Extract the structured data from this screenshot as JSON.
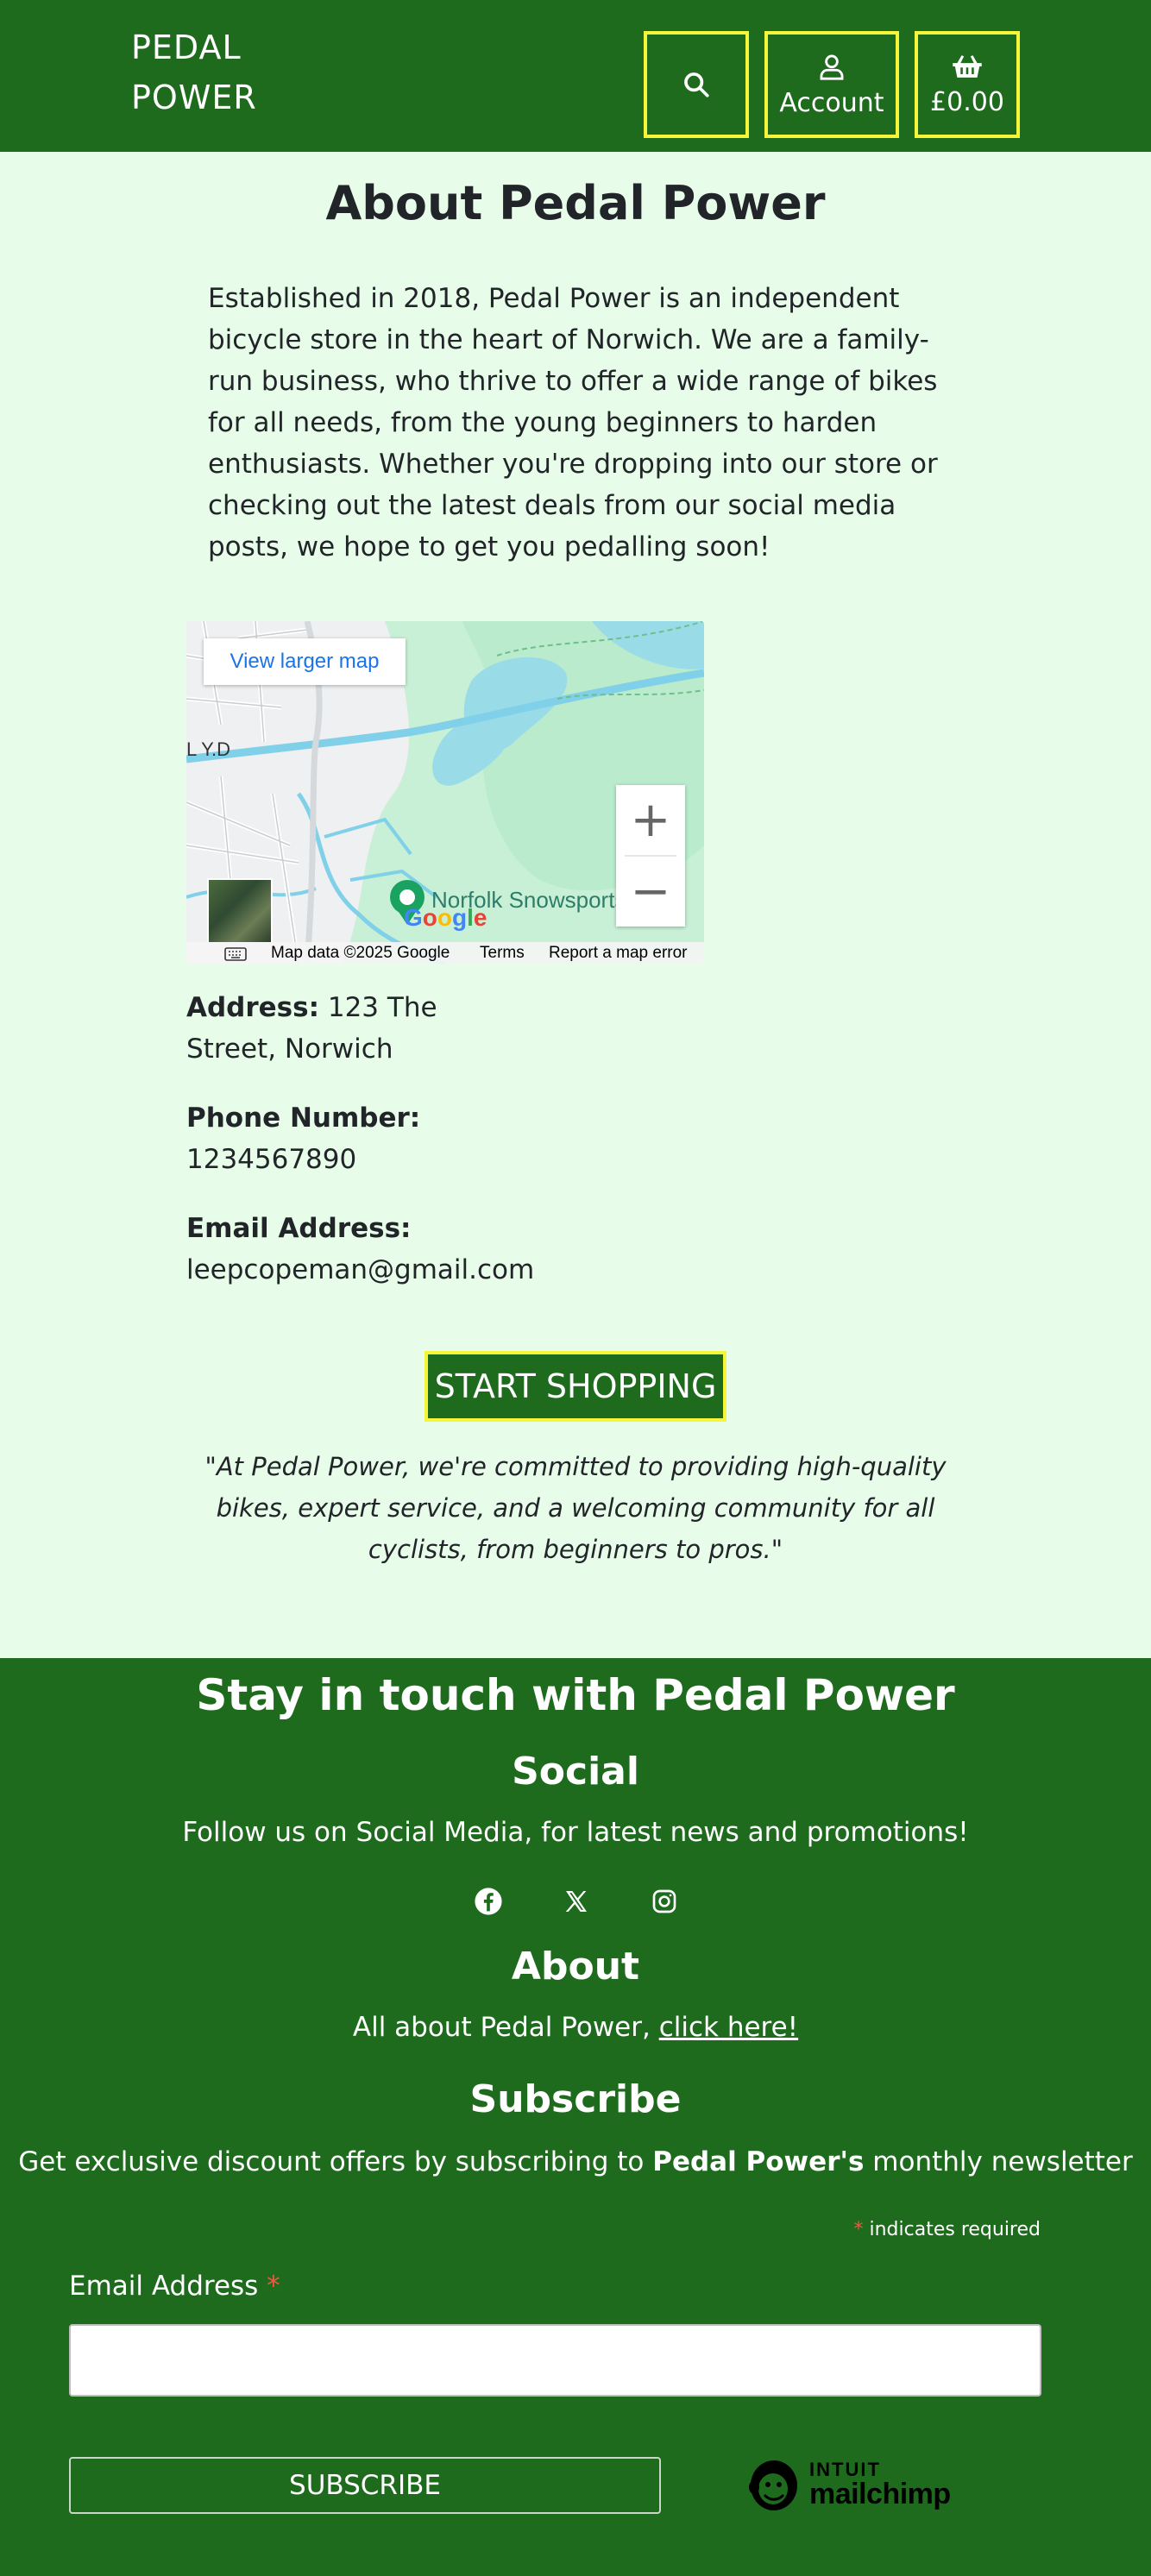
{
  "header": {
    "brand_line1": "PEDAL",
    "brand_line2": "POWER",
    "search_icon": "search-icon",
    "account_label": "Account",
    "account_icon": "user-icon",
    "basket_total": "£0.00",
    "basket_icon": "basket-icon",
    "colors": {
      "bar": "#1e6b1e",
      "focus_outline": "#f5f53a"
    }
  },
  "main": {
    "title": "About Pedal Power",
    "intro": "Established in 2018, Pedal Power is an independent bicycle store in the heart of Norwich. We are a family-run business, who thrive to offer a wide range of bikes for all needs, from the young beginners to harden enthusiasts. Whether you're dropping into our store or checking out the latest deals from our social media posts, we hope to get you pedalling soon!",
    "map": {
      "view_larger": "View larger map",
      "place_label": "Norfolk Snowsports Club",
      "area_label": "L Y.D",
      "zoom_in": "+",
      "zoom_out": "−",
      "google": "Google",
      "map_data": "Map data ©2025 Google",
      "terms": "Terms",
      "report": "Report a map error",
      "keyboard_icon": "keyboard-icon"
    },
    "address_label": "Address:",
    "address_line1": "123 The",
    "address_line2": "Street, Norwich",
    "phone_label": "Phone Number:",
    "phone_value": "1234567890",
    "email_label": "Email Address:",
    "email_value": "leepcopeman@gmail.com",
    "cta_label": "START SHOPPING",
    "quote": "\"At Pedal Power, we're committed to providing high-quality bikes, expert service, and a welcoming community for all cyclists, from beginners to pros.\""
  },
  "footer": {
    "heading": "Stay in touch with Pedal Power",
    "social_heading": "Social",
    "social_text": "Follow us on Social Media, for latest news and promotions!",
    "social_icons": [
      "facebook-icon",
      "x-icon",
      "instagram-icon"
    ],
    "about_heading": "About",
    "about_text": "All about Pedal Power, ",
    "about_link": "click here!",
    "subscribe_heading": "Subscribe",
    "subscribe_text_pre": "Get exclusive discount offers by subscribing to ",
    "subscribe_text_bold": "Pedal Power's",
    "subscribe_text_post": " monthly newsletter",
    "required_star": "*",
    "required_note": " indicates required",
    "email_field_label": "Email Address ",
    "email_placeholder": "",
    "subscribe_button": "SUBSCRIBE",
    "mailchimp_line1": "INTUIT",
    "mailchimp_line2": "mailchimp",
    "colors": {
      "background": "#1e6b1e",
      "required": "#e85c41"
    }
  }
}
